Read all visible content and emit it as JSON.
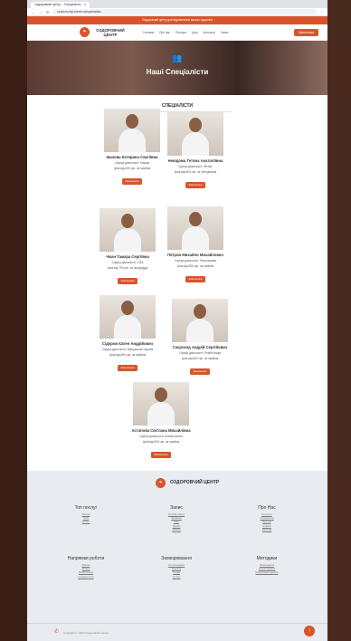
{
  "browser": {
    "tab_title": "Оздоровчий центр – Спеціалісти",
    "address": "ozdorovchyi-tsentr.ua/specialists"
  },
  "promo_text": "Оздоровчий центр для відновлення вашого здоров'я",
  "header": {
    "brand": "ОЗДОРОВЧИЙ ЦЕНТР",
    "nav": [
      "Головна",
      "Про нас",
      "Послуги",
      "Ціни",
      "Контакти",
      "Запис"
    ],
    "cta": "Записатися"
  },
  "hero": {
    "icon": "users-icon",
    "title": "Наші Спеціалісти"
  },
  "section_title": "СПЕЦІАЛІСТИ",
  "book_label": "Записатися",
  "specialists": [
    {
      "name": "Іванова Катерина Сергіївна",
      "specialty": "Сфера діяльності: Масаж",
      "price": "Ціна від 600 грн. за прийом"
    },
    {
      "name": "Невідома Тетяна Анатоліївна",
      "specialty": "Сфера діяльності: Фітнес",
      "price": "Ціна від 500 грн. за тренування"
    },
    {
      "name": "Чжан Тамара Сергіївна",
      "specialty": "Сфера діяльності: СПА",
      "price": "Ціна від 700 грн. за процедуру"
    },
    {
      "name": "Петров Михайло Михайлович",
      "specialty": "Сфера діяльності: Фізіотерапія",
      "price": "Ціна від 550 грн. за прийом"
    },
    {
      "name": "Сідоров Євген Андрійович",
      "specialty": "Сфера діяльності: Мануальна терапія",
      "price": "Ціна від 650 грн. за прийом"
    },
    {
      "name": "Скороход Андрій Сергійович",
      "specialty": "Сфера діяльності: Реабілітація",
      "price": "Ціна від 600 грн. за прийом"
    },
    {
      "name": "Астапова Світлана Михайлівна",
      "specialty": "Сфера діяльності: Косметологія",
      "price": "Ціна від 500 грн. за прийом"
    }
  ],
  "footer": {
    "brand": "ОЗДОРОВЧИЙ ЦЕНТР",
    "columns": [
      {
        "title": "Топ послуг",
        "items": [
          "Масаж",
          "СПА",
          "Фітнес"
        ]
      },
      {
        "title": "Запис",
        "items": [
          "Онлайн-запис",
          "Телефон",
          "Ціни",
          "Графік",
          "Знижки"
        ]
      },
      {
        "title": "Про Нас",
        "items": [
          "Контакти",
          "Спеціалісти",
          "Відгуки",
          "Новини",
          "Вакансії"
        ]
      },
      {
        "title": "Напрямки роботи",
        "items": [
          "Масаж",
          "Фітнес",
          "Реабілітація",
          "Косметологія"
        ]
      },
      {
        "title": "Захворювання",
        "items": [
          "Остеохондроз",
          "Сколіоз",
          "Грижа",
          "Артрит"
        ]
      },
      {
        "title": "Методики",
        "items": [
          "Фізіотерапія",
          "Кінезіотерапія",
          "Мануальна терапія"
        ]
      }
    ],
    "copyright": "Copyright © 2023 Оздоровчий центр"
  }
}
